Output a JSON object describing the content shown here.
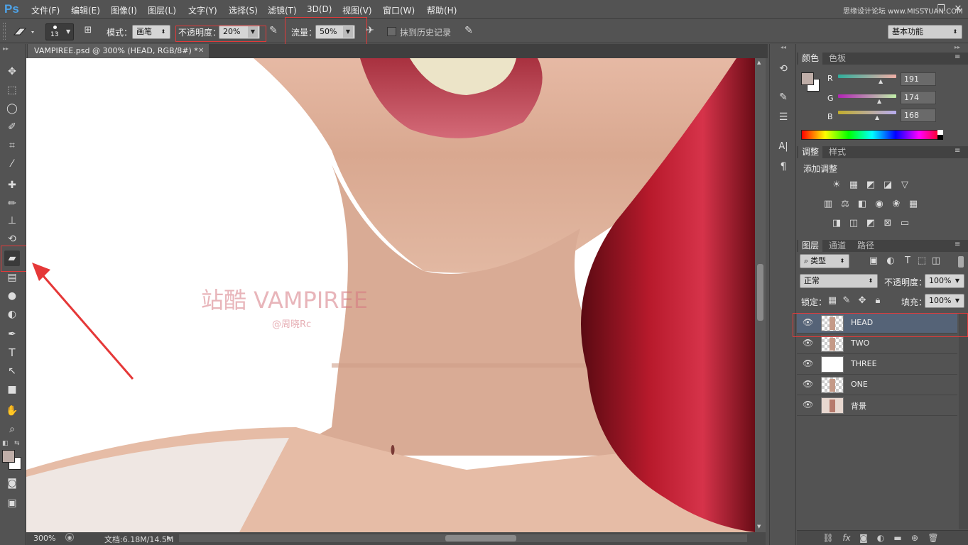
{
  "app": {
    "logo": "Ps"
  },
  "menu": [
    "文件(F)",
    "编辑(E)",
    "图像(I)",
    "图层(L)",
    "文字(Y)",
    "选择(S)",
    "滤镜(T)",
    "3D(D)",
    "视图(V)",
    "窗口(W)",
    "帮助(H)"
  ],
  "watermark": "思缘设计论坛 www.MISSYUAN.COM",
  "window_controls": {
    "minimize": "—",
    "restore": "❐",
    "close": "✕"
  },
  "options": {
    "brush_size": "13",
    "mode_label": "模式：",
    "mode_value": "画笔",
    "opacity_label": "不透明度：",
    "opacity_value": "20%",
    "flow_label": "流量：",
    "flow_value": "50%",
    "history_label": "抹到历史记录",
    "workspace": "基本功能"
  },
  "document": {
    "tab_title": "VAMPIREE.psd @ 300% (HEAD, RGB/8#) *",
    "overlay_title": "站酷 VAMPIREE",
    "overlay_credit": "@周晓Rc"
  },
  "status": {
    "zoom": "300%",
    "doc_size": "文档:6.18M/14.5M"
  },
  "color_panel": {
    "tabs": [
      "颜色",
      "色板"
    ],
    "r_label": "R",
    "g_label": "G",
    "b_label": "B",
    "r_value": "191",
    "g_value": "174",
    "b_value": "168",
    "foreground": "#bfaea8"
  },
  "adjust_panel": {
    "tabs": [
      "调整",
      "样式"
    ],
    "title": "添加调整"
  },
  "layers_panel": {
    "tabs": [
      "图层",
      "通道",
      "路径"
    ],
    "filter_type": "类型",
    "blend_mode": "正常",
    "opacity_label": "不透明度：",
    "opacity_value": "100%",
    "lock_label": "锁定：",
    "fill_label": "填充：",
    "fill_value": "100%",
    "layers": [
      {
        "name": "HEAD",
        "selected": true
      },
      {
        "name": "TWO",
        "selected": false
      },
      {
        "name": "THREE",
        "selected": false
      },
      {
        "name": "ONE",
        "selected": false
      },
      {
        "name": "背景",
        "selected": false
      }
    ]
  }
}
